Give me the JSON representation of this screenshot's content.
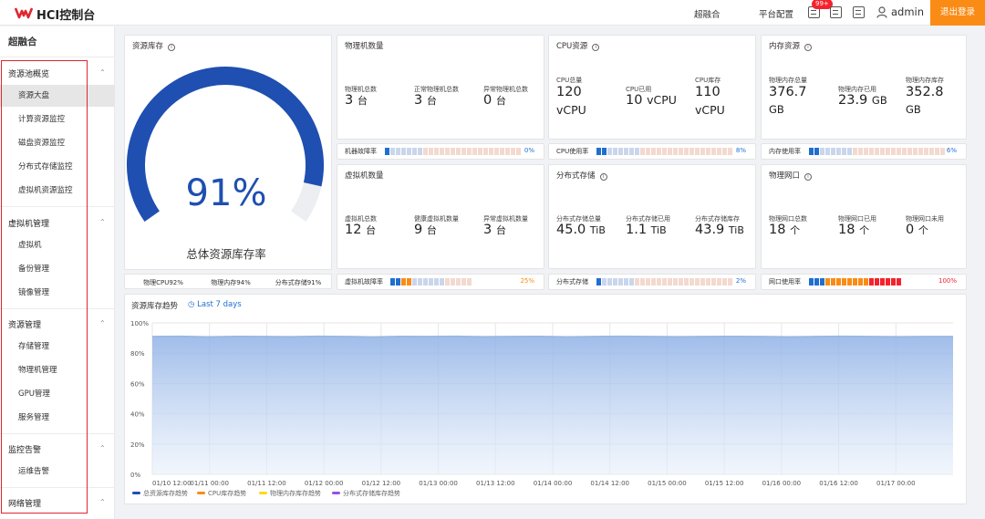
{
  "header": {
    "app_title": "HCI控制台",
    "nav": [
      "超融合",
      "平台配置"
    ],
    "notification_badge": "99+",
    "username": "admin",
    "logout_label": "退出登录"
  },
  "sidebar": {
    "title": "超融合",
    "groups": [
      {
        "label": "资源池概览",
        "items": [
          "资源大盘",
          "计算资源监控",
          "磁盘资源监控",
          "分布式存储监控",
          "虚拟机资源监控"
        ]
      },
      {
        "label": "虚拟机管理",
        "items": [
          "虚拟机",
          "备份管理",
          "镜像管理"
        ]
      },
      {
        "label": "资源管理",
        "items": [
          "存储管理",
          "物理机管理",
          "GPU管理",
          "服务管理"
        ]
      },
      {
        "label": "监控告警",
        "items": [
          "运维告警"
        ]
      },
      {
        "label": "网络管理",
        "items": []
      }
    ],
    "active_item": "资源大盘"
  },
  "gauge": {
    "title": "资源库存",
    "percent_text": "91%",
    "percent_value": 91,
    "caption": "总体资源库存率",
    "strip": [
      "物理CPU92%",
      "物理内存94%",
      "分布式存储91%"
    ]
  },
  "cards": {
    "physical": {
      "title": "物理机数量",
      "metrics": [
        {
          "label": "物理机总数",
          "value": "3",
          "unit": "台"
        },
        {
          "label": "正常物理机总数",
          "value": "3",
          "unit": "台"
        },
        {
          "label": "异常物理机总数",
          "value": "0",
          "unit": "台"
        }
      ],
      "bar": {
        "label": "机器故障率",
        "percent": "0%",
        "value": 0,
        "color": "#1f6fd0",
        "filled": 1,
        "total": 25
      }
    },
    "cpu": {
      "title": "CPU资源",
      "metrics": [
        {
          "label": "CPU总量",
          "value": "120",
          "unit": "vCPU"
        },
        {
          "label": "CPU已用",
          "value": "10",
          "unit": "vCPU"
        },
        {
          "label": "CPU库存",
          "value": "110",
          "unit": "vCPU"
        }
      ],
      "bar": {
        "label": "CPU使用率",
        "percent": "8%",
        "value": 8,
        "color": "#1f6fd0",
        "filled": 2,
        "total": 25
      }
    },
    "memory": {
      "title": "内存资源",
      "metrics": [
        {
          "label": "物理内存总量",
          "value": "376.7",
          "unit": "GB"
        },
        {
          "label": "物理内存已用",
          "value": "23.9",
          "unit": "GB"
        },
        {
          "label": "物理内存库存",
          "value": "352.8",
          "unit": "GB"
        }
      ],
      "bar": {
        "label": "内存使用率",
        "percent": "6%",
        "value": 6,
        "color": "#1f6fd0",
        "filled": 2,
        "total": 25
      }
    },
    "vm": {
      "title": "虚拟机数量",
      "metrics": [
        {
          "label": "虚拟机总数",
          "value": "12",
          "unit": "台"
        },
        {
          "label": "健康虚拟机数量",
          "value": "9",
          "unit": "台"
        },
        {
          "label": "异常虚拟机数量",
          "value": "3",
          "unit": "台"
        }
      ],
      "bar": {
        "label": "虚拟机故障率",
        "percent": "25%",
        "value": 25,
        "color": "#fa8c16",
        "filled": 4,
        "total": 15
      }
    },
    "storage": {
      "title": "分布式存储",
      "metrics": [
        {
          "label": "分布式存储总量",
          "value": "45.0",
          "unit": "TiB"
        },
        {
          "label": "分布式存储已用",
          "value": "1.1",
          "unit": "TiB"
        },
        {
          "label": "分布式存储库存",
          "value": "43.9",
          "unit": "TiB"
        }
      ],
      "bar": {
        "label": "分布式存储",
        "percent": "2%",
        "value": 2,
        "color": "#1f6fd0",
        "filled": 1,
        "total": 25
      }
    },
    "network": {
      "title": "物理网口",
      "metrics": [
        {
          "label": "物理网口总数",
          "value": "18",
          "unit": "个"
        },
        {
          "label": "物理网口已用",
          "value": "18",
          "unit": "个"
        },
        {
          "label": "物理网口未用",
          "value": "0",
          "unit": "个"
        }
      ],
      "bar": {
        "label": "网口使用率",
        "percent": "100%",
        "value": 100,
        "color": "#f5222d",
        "filled": 17,
        "total": 17
      }
    }
  },
  "trend": {
    "title": "资源库存趋势",
    "range_label": "Last 7 days",
    "legend": [
      {
        "name": "总资源库存趋势",
        "color": "#1f4fb0"
      },
      {
        "name": "CPU库存趋势",
        "color": "#fa8c16"
      },
      {
        "name": "物理内存库存趋势",
        "color": "#fadb14"
      },
      {
        "name": "分布式存储库存趋势",
        "color": "#9254de"
      }
    ]
  },
  "chart_data": {
    "type": "area",
    "title": "资源库存趋势",
    "y_ticks": [
      "100%",
      "80%",
      "60%",
      "40%",
      "20%",
      "0%"
    ],
    "ylim": [
      0,
      100
    ],
    "x_ticks": [
      "01/10 12:00",
      "01/11 00:00",
      "01/11 12:00",
      "01/12 00:00",
      "01/12 12:00",
      "01/13 00:00",
      "01/13 12:00",
      "01/14 00:00",
      "01/14 12:00",
      "01/15 00:00",
      "01/15 12:00",
      "01/16 00:00",
      "01/16 12:00",
      "01/17 00:00"
    ],
    "grid": true,
    "series": [
      {
        "name": "总资源库存趋势",
        "values": [
          91,
          91.2,
          90.8,
          91.1,
          91,
          90.9,
          91.2,
          91,
          90.7,
          91.1,
          91,
          91.2,
          90.9,
          91,
          91.1,
          90.8,
          91,
          91.2,
          91,
          90.9,
          91,
          91.1,
          91,
          90.8,
          91,
          91.2,
          91,
          90.9,
          91,
          91
        ]
      }
    ]
  }
}
